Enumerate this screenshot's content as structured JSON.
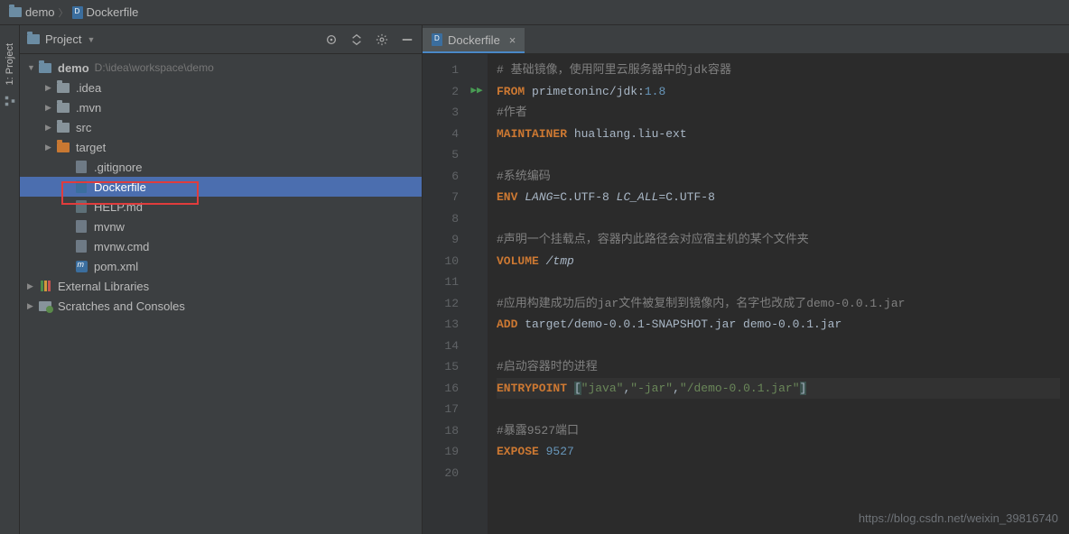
{
  "breadcrumb": {
    "root": "demo",
    "file": "Dockerfile"
  },
  "sidebar": {
    "title": "Project",
    "vtab": "1: Project",
    "tree": {
      "root": {
        "name": "demo",
        "path": "D:\\idea\\workspace\\demo"
      },
      "children": [
        {
          "name": ".idea",
          "type": "folder",
          "indent": 1
        },
        {
          "name": ".mvn",
          "type": "folder",
          "indent": 1
        },
        {
          "name": "src",
          "type": "folder",
          "indent": 1
        },
        {
          "name": "target",
          "type": "folder-orange",
          "indent": 1
        },
        {
          "name": ".gitignore",
          "type": "file",
          "indent": 2
        },
        {
          "name": "Dockerfile",
          "type": "docker",
          "indent": 2,
          "selected": true
        },
        {
          "name": "HELP.md",
          "type": "md",
          "indent": 2
        },
        {
          "name": "mvnw",
          "type": "file",
          "indent": 2
        },
        {
          "name": "mvnw.cmd",
          "type": "file",
          "indent": 2
        },
        {
          "name": "pom.xml",
          "type": "xml",
          "indent": 2
        }
      ],
      "extLibs": "External Libraries",
      "scratches": "Scratches and Consoles"
    }
  },
  "editor": {
    "tab": "Dockerfile",
    "lines": [
      {
        "n": 1,
        "segs": [
          {
            "t": "# 基础镜像，使用阿里云服务器中的jdk容器",
            "c": "cmt"
          }
        ]
      },
      {
        "n": 2,
        "run": true,
        "segs": [
          {
            "t": "FROM",
            "c": "kw"
          },
          {
            "t": " ",
            "c": "id"
          },
          {
            "t": "primetoninc/jdk:",
            "c": "id"
          },
          {
            "t": "1.8",
            "c": "num"
          }
        ]
      },
      {
        "n": 3,
        "segs": [
          {
            "t": "#作者",
            "c": "cmt"
          }
        ]
      },
      {
        "n": 4,
        "segs": [
          {
            "t": "MAINTAINER",
            "c": "kw"
          },
          {
            "t": " hualiang.liu-ext",
            "c": "id"
          }
        ]
      },
      {
        "n": 5,
        "segs": []
      },
      {
        "n": 6,
        "segs": [
          {
            "t": "#系统编码",
            "c": "cmt"
          }
        ]
      },
      {
        "n": 7,
        "segs": [
          {
            "t": "ENV",
            "c": "kw"
          },
          {
            "t": " ",
            "c": "id"
          },
          {
            "t": "LANG",
            "c": "id ital"
          },
          {
            "t": "=C.UTF-8 ",
            "c": "id"
          },
          {
            "t": "LC_ALL",
            "c": "id ital"
          },
          {
            "t": "=C.UTF-8",
            "c": "id"
          }
        ]
      },
      {
        "n": 8,
        "segs": []
      },
      {
        "n": 9,
        "segs": [
          {
            "t": "#声明一个挂载点，容器内此路径会对应宿主机的某个文件夹",
            "c": "cmt"
          }
        ]
      },
      {
        "n": 10,
        "segs": [
          {
            "t": "VOLUME",
            "c": "kw"
          },
          {
            "t": " ",
            "c": "id"
          },
          {
            "t": "/tmp",
            "c": "id ital"
          }
        ]
      },
      {
        "n": 11,
        "segs": []
      },
      {
        "n": 12,
        "segs": [
          {
            "t": "#应用构建成功后的jar文件被复制到镜像内，名字也改成了demo-0.0.1.jar",
            "c": "cmt"
          }
        ]
      },
      {
        "n": 13,
        "segs": [
          {
            "t": "ADD",
            "c": "kw"
          },
          {
            "t": " target/demo-0.0.1-SNAPSHOT.jar demo-0.0.1.jar",
            "c": "id"
          }
        ]
      },
      {
        "n": 14,
        "segs": []
      },
      {
        "n": 15,
        "segs": [
          {
            "t": "#启动容器时的进程",
            "c": "cmt"
          }
        ]
      },
      {
        "n": 16,
        "hl": true,
        "segs": [
          {
            "t": "ENTRYPOINT",
            "c": "kw"
          },
          {
            "t": " ",
            "c": "id"
          },
          {
            "t": "[",
            "c": "id bracket"
          },
          {
            "t": "\"java\"",
            "c": "str"
          },
          {
            "t": ",",
            "c": "id"
          },
          {
            "t": "\"-jar\"",
            "c": "str"
          },
          {
            "t": ",",
            "c": "id"
          },
          {
            "t": "\"/demo-0.0.1.jar\"",
            "c": "str"
          },
          {
            "t": "]",
            "c": "id bracket"
          }
        ]
      },
      {
        "n": 17,
        "segs": []
      },
      {
        "n": 18,
        "segs": [
          {
            "t": "#暴露9527端口",
            "c": "cmt"
          }
        ]
      },
      {
        "n": 19,
        "segs": [
          {
            "t": "EXPOSE",
            "c": "kw"
          },
          {
            "t": " ",
            "c": "id"
          },
          {
            "t": "9527",
            "c": "num"
          }
        ]
      },
      {
        "n": 20,
        "segs": []
      }
    ]
  },
  "watermark": "https://blog.csdn.net/weixin_39816740"
}
